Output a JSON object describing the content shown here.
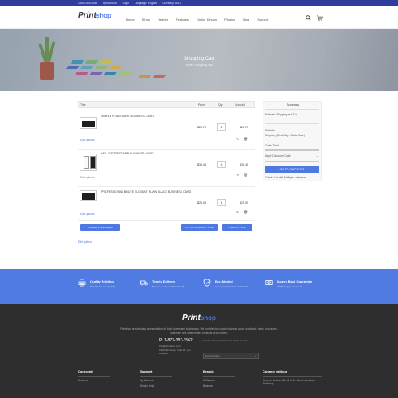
{
  "topbar": {
    "items": [
      "1-800-555-0188",
      "My Account",
      "Login",
      "Language: English",
      "Currency: USD"
    ]
  },
  "header": {
    "logo_main": "Print",
    "logo_accent": "shop",
    "nav": [
      "Home",
      "Shop",
      "Header",
      "Features",
      "Online Design",
      "Plugins",
      "Blog",
      "Support"
    ],
    "search_icon": "search-icon",
    "cart_icon": "cart-icon"
  },
  "hero": {
    "title": "Shopping Cart",
    "breadcrumb": "Home / Shopping Cart"
  },
  "cart": {
    "columns": [
      "Title",
      "Price",
      "Qty",
      "Subtotal"
    ],
    "items": [
      {
        "name": "SIMPLE PLAIN DARK BUSINESS CARD",
        "price": "$26.75",
        "qty": "1",
        "subtotal": "$26.75",
        "edit": "Edit options"
      },
      {
        "name": "HELLO STREETWEB BUSINESS CARD",
        "price": "$30.45",
        "qty": "1",
        "subtotal": "$30.45",
        "edit": "Edit options"
      },
      {
        "name": "PROFESSIONAL BRUTE ELEGANT PLAIN BLACK BUSINESS CARD",
        "price": "$25.05",
        "qty": "1",
        "subtotal": "$25.05",
        "edit": "Edit options"
      }
    ],
    "buttons": {
      "continue": "CONTINUE SHOPPING",
      "clear": "CLEAR SHOPPING CART",
      "update": "UPDATE CART"
    },
    "all_options": "Edit options"
  },
  "summary": {
    "title": "Summary",
    "estimate": "Estimate Shipping and Tax",
    "subtotal_label": "Subtotal",
    "shipping_label": "Shipping (Best Way - Table Rate)",
    "order_total_label": "Order Total",
    "discount_label": "Apply Discount Code",
    "checkout": "GO TO CHECKOUT",
    "multi_address": "Check Out with Multiple Addresses"
  },
  "features": [
    {
      "icon": "printer-icon",
      "title": "Quality Printing",
      "desc": "Provide the best quality"
    },
    {
      "icon": "truck-icon",
      "title": "Timely Delivery",
      "desc": "Receive on time without trouble"
    },
    {
      "icon": "shield-icon",
      "title": "Eco-Minded",
      "desc": "All our products are eco-friendly"
    },
    {
      "icon": "money-icon",
      "title": "Money Back Guarantee",
      "desc": "100% happy customers"
    }
  ],
  "footer": {
    "logo_main": "Print",
    "logo_accent": "shop",
    "description": "Printshop provides fast online printing for both homes and businesses. We provide high quality business cards, postcards, flyers, brochures, stationery and other printed products at low prices.",
    "phone": "P: 1-877-387-1562",
    "email": "info@printshop.com",
    "address": "3734 Hill Street, Suite 99, Los Angeles",
    "newsletter": "Get the latest product news, deals & more",
    "email_placeholder": "Email Address",
    "columns": [
      {
        "heading": "Corporate",
        "links": [
          "About us"
        ]
      },
      {
        "heading": "Support",
        "links": [
          "My Account",
          "Design Help"
        ]
      },
      {
        "heading": "Brands",
        "links": [
          "All Brands",
          "Business"
        ]
      },
      {
        "heading": "Connect with us",
        "text": "Keep up to date with all of the latest news from Printshop"
      }
    ]
  },
  "colors": {
    "accent": "#4f79e0",
    "topbar": "#2f3e9e",
    "footer": "#2e2e2e"
  }
}
